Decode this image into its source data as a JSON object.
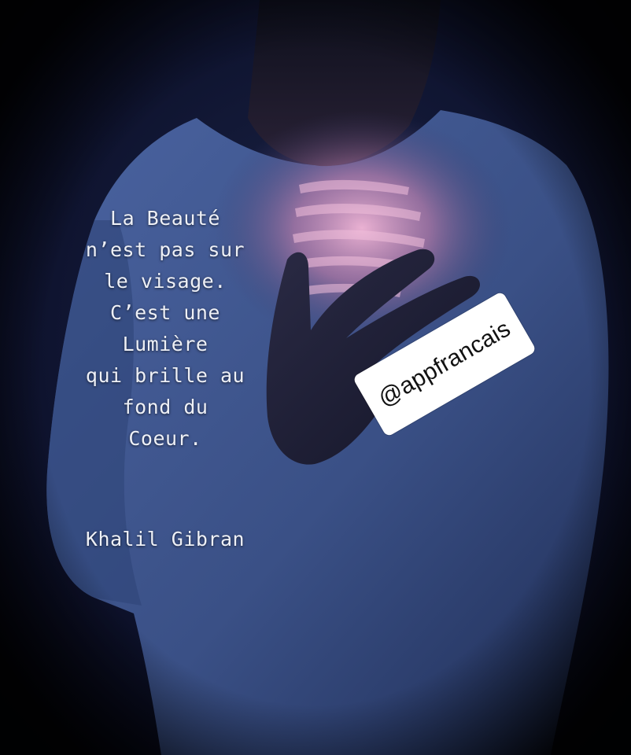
{
  "quote": {
    "lines": [
      "La Beauté",
      "n’est pas sur",
      "le visage.",
      "C’est une",
      "Lumière",
      "qui brille au",
      "fond du",
      "Coeur."
    ]
  },
  "author": "Khalil Gibran",
  "watermark": "@appfrancais",
  "colors": {
    "background": "#0a0d1c",
    "shirt": "#3c5484",
    "glow": "#c88ab0",
    "text": "#eef0f6",
    "sticker": "#ffffff"
  }
}
